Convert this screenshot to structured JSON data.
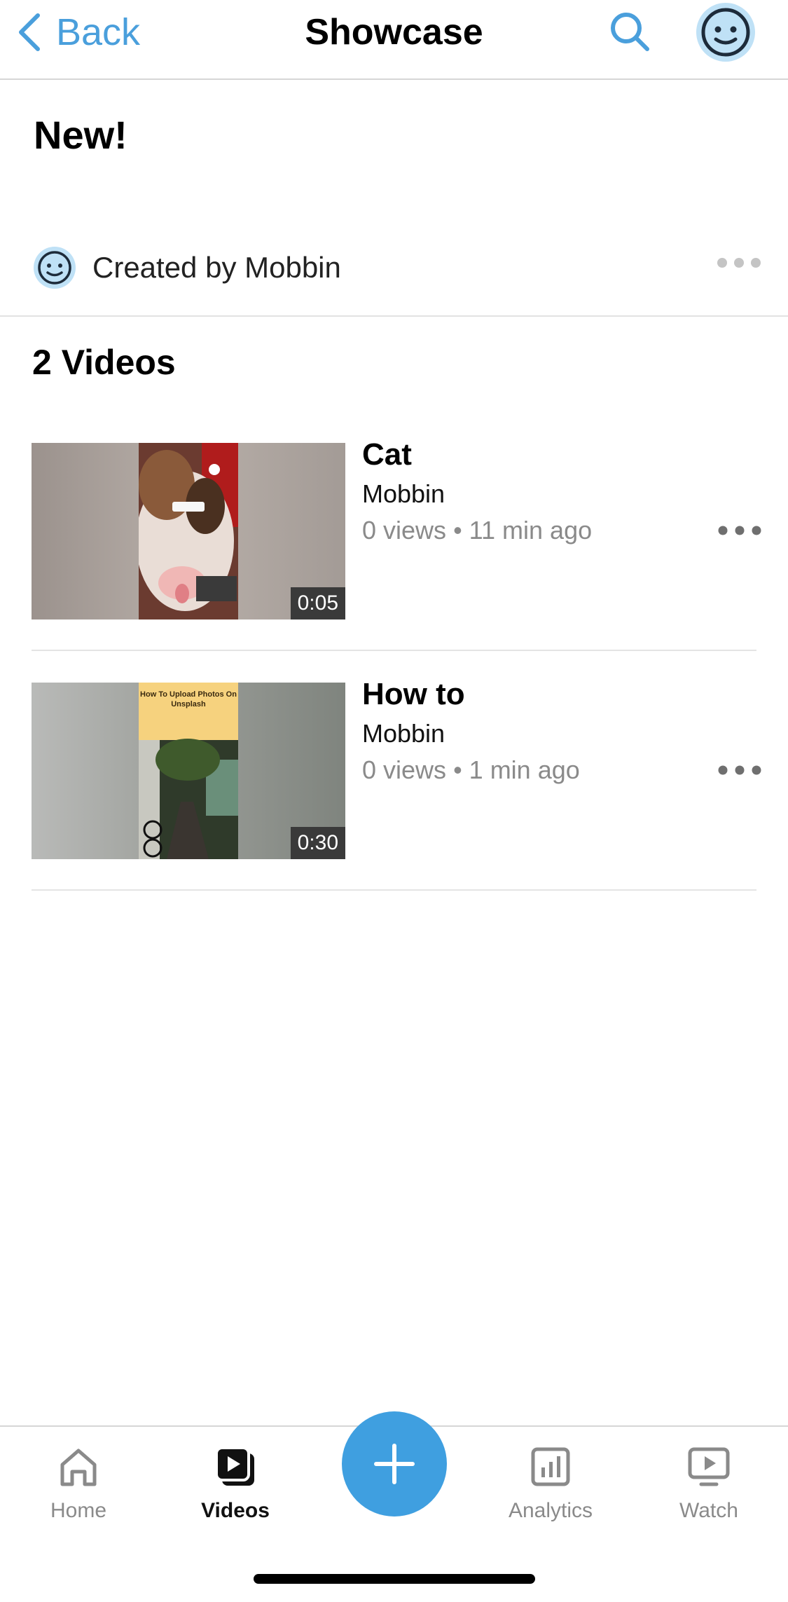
{
  "header": {
    "back_label": "Back",
    "title": "Showcase"
  },
  "playlist": {
    "title": "New!",
    "creator": "Created by Mobbin",
    "count_label": "2 Videos"
  },
  "videos": [
    {
      "title": "Cat",
      "author": "Mobbin",
      "views": "0 views",
      "age": "11 min ago",
      "duration": "0:05"
    },
    {
      "title": "How to",
      "author": "Mobbin",
      "views": "0 views",
      "age": "1 min ago",
      "duration": "0:30",
      "thumbnail_caption": "How To Upload Photos On Unsplash"
    }
  ],
  "tabs": [
    {
      "label": "Home",
      "icon": "home-icon"
    },
    {
      "label": "Videos",
      "icon": "videos-icon",
      "active": true
    },
    {
      "label": "Analytics",
      "icon": "analytics-icon"
    },
    {
      "label": "Watch",
      "icon": "watch-icon"
    }
  ],
  "colors": {
    "accent": "#4a9fdc",
    "fab": "#3f9fe0",
    "avatar": "#bfe1f6"
  }
}
